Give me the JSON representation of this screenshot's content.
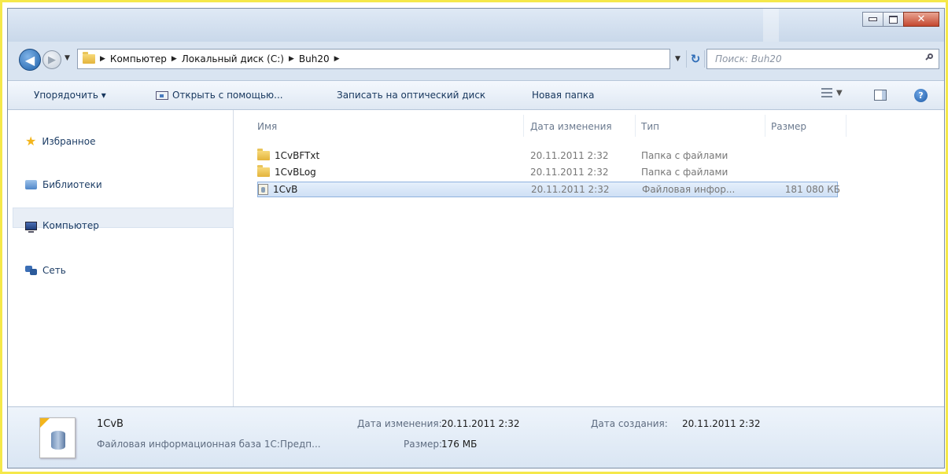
{
  "window": {
    "title_buttons": {
      "minimize_icon": "minimize-icon",
      "maximize_icon": "maximize-icon",
      "close_icon": "close-icon"
    }
  },
  "address": {
    "crumbs": [
      "Компьютер",
      "Локальный диск (C:)",
      "Buh20"
    ],
    "search_placeholder": "Поиск: Buh20"
  },
  "toolbar": {
    "organize": "Упорядочить ▾",
    "open_with": "Открыть с помощью...",
    "burn": "Записать на оптический диск",
    "new_folder": "Новая папка"
  },
  "sidebar": {
    "items": [
      {
        "label": "Избранное",
        "icon": "star-icon"
      },
      {
        "label": "Библиотеки",
        "icon": "libraries-icon"
      },
      {
        "label": "Компьютер",
        "icon": "computer-icon"
      },
      {
        "label": "Сеть",
        "icon": "network-icon"
      }
    ]
  },
  "columns": {
    "name": "Имя",
    "date": "Дата изменения",
    "type": "Тип",
    "size": "Размер"
  },
  "files": [
    {
      "name": "1CvBFTxt",
      "date": "20.11.2011 2:32",
      "type": "Папка с файлами",
      "size": "",
      "icon": "folder-icon"
    },
    {
      "name": "1CvBLog",
      "date": "20.11.2011 2:32",
      "type": "Папка с файлами",
      "size": "",
      "icon": "folder-icon"
    },
    {
      "name": "1CvB",
      "date": "20.11.2011 2:32",
      "type": "Файловая инфор...",
      "size": "181 080 КБ",
      "icon": "database-file-icon",
      "selected": true
    }
  ],
  "details": {
    "name": "1CvB",
    "description": "Файловая информационная база 1С:Предп...",
    "modified_label": "Дата изменения:",
    "modified_value": "20.11.2011 2:32",
    "size_label": "Размер:",
    "size_value": "176 МБ",
    "created_label": "Дата создания:",
    "created_value": "20.11.2011 2:32"
  },
  "colors": {
    "accent": "#2f6db7",
    "selection": "#cfe0f5",
    "highlight_border": "#f5e84a"
  }
}
